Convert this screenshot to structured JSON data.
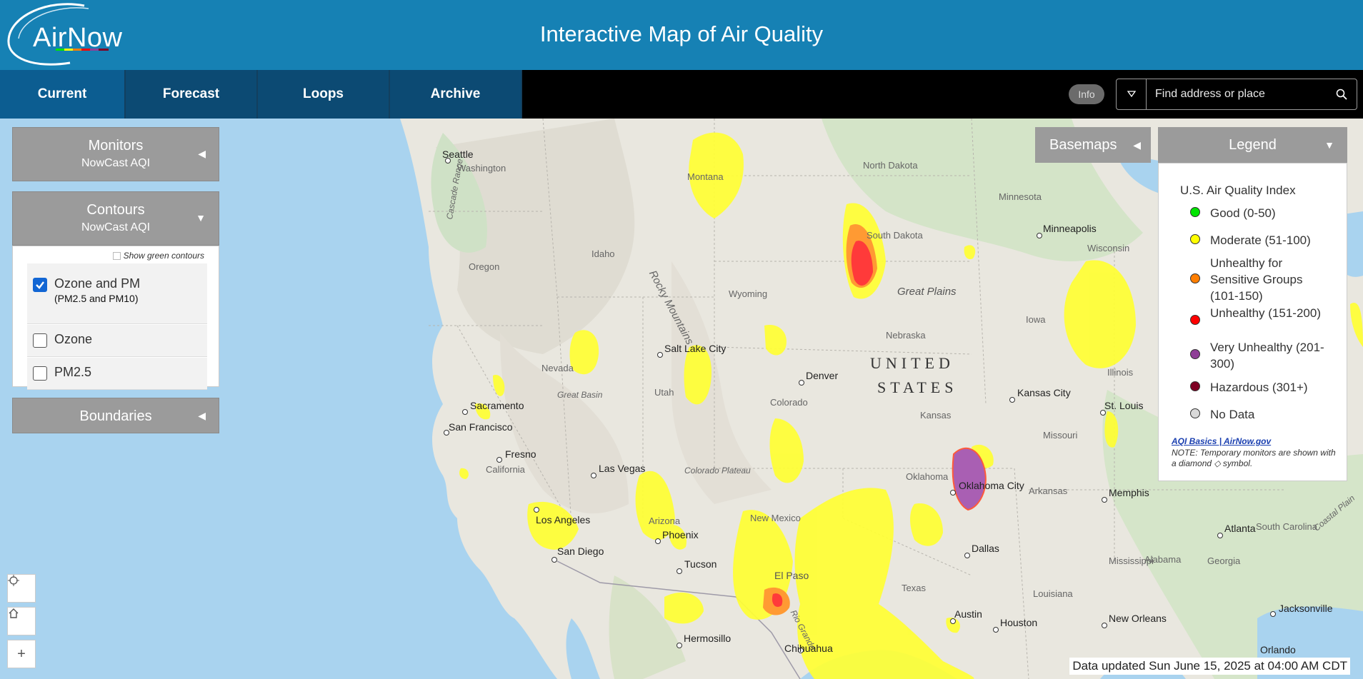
{
  "header": {
    "logo_text": "AirNow",
    "title": "Interactive Map of Air Quality"
  },
  "nav": {
    "tabs": [
      {
        "label": "Current",
        "active": true
      },
      {
        "label": "Forecast",
        "active": false
      },
      {
        "label": "Loops",
        "active": false
      },
      {
        "label": "Archive",
        "active": false
      }
    ],
    "info_label": "Info",
    "search_placeholder": "Find address or place"
  },
  "panels": {
    "monitors": {
      "title": "Monitors",
      "subtitle": "NowCast AQI"
    },
    "contours": {
      "title": "Contours",
      "subtitle": "NowCast AQI",
      "show_green_label": "Show green contours",
      "options": [
        {
          "label": "Ozone and PM",
          "sub": "(PM2.5 and PM10)",
          "checked": true
        },
        {
          "label": "Ozone",
          "sub": "",
          "checked": false
        },
        {
          "label": "PM2.5",
          "sub": "",
          "checked": false
        }
      ]
    },
    "boundaries": {
      "title": "Boundaries"
    }
  },
  "basemaps_label": "Basemaps",
  "legend": {
    "head": "Legend",
    "title": "U.S. Air Quality Index",
    "items": [
      {
        "label": "Good (0-50)",
        "color": "#00e400"
      },
      {
        "label": "Moderate (51-100)",
        "color": "#ffff00"
      },
      {
        "label": "Unhealthy for Sensitive Groups (101-150)",
        "color": "#ff7e00"
      },
      {
        "label": "Unhealthy (151-200)",
        "color": "#ff0000"
      },
      {
        "label": "Very Unhealthy (201-300)",
        "color": "#8f3f97"
      },
      {
        "label": "Hazardous (301+)",
        "color": "#7e0023"
      },
      {
        "label": "No Data",
        "color": "#d9d9d9"
      }
    ],
    "link": "AQI Basics | AirNow.gov",
    "note": "NOTE: Temporary monitors are shown with a diamond ◇ symbol."
  },
  "map": {
    "country": [
      "UNITED",
      "STATES"
    ],
    "states": [
      "Washington",
      "Oregon",
      "Idaho",
      "Montana",
      "Wyoming",
      "Nevada",
      "Utah",
      "California",
      "Arizona",
      "Colorado",
      "New Mexico",
      "North Dakota",
      "South Dakota",
      "Nebraska",
      "Kansas",
      "Oklahoma",
      "Texas",
      "Minnesota",
      "Iowa",
      "Wisconsin",
      "Illinois",
      "Missouri",
      "Arkansas",
      "Louisiana",
      "Mississippi",
      "Alabama",
      "Georgia",
      "South Carolina"
    ],
    "features": [
      "Rocky Mountains",
      "Great Plains",
      "Great Basin",
      "Colorado Plateau",
      "Cascade Range",
      "Coastal Plain",
      "Rio Grande"
    ],
    "cities": [
      "Seattle",
      "Salt Lake City",
      "Denver",
      "Sacramento",
      "San Francisco",
      "Fresno",
      "Las Vegas",
      "Los Angeles",
      "San Diego",
      "Phoenix",
      "Tucson",
      "El Paso",
      "Chihuahua",
      "Hermosillo",
      "Minneapolis",
      "Kansas City",
      "St. Louis",
      "Oklahoma City",
      "Dallas",
      "Austin",
      "Houston",
      "Memphis",
      "Atlanta",
      "New Orleans",
      "Jacksonville",
      "Orlando"
    ],
    "updated": "Data updated Sun June 15, 2025 at 04:00 AM CDT"
  }
}
